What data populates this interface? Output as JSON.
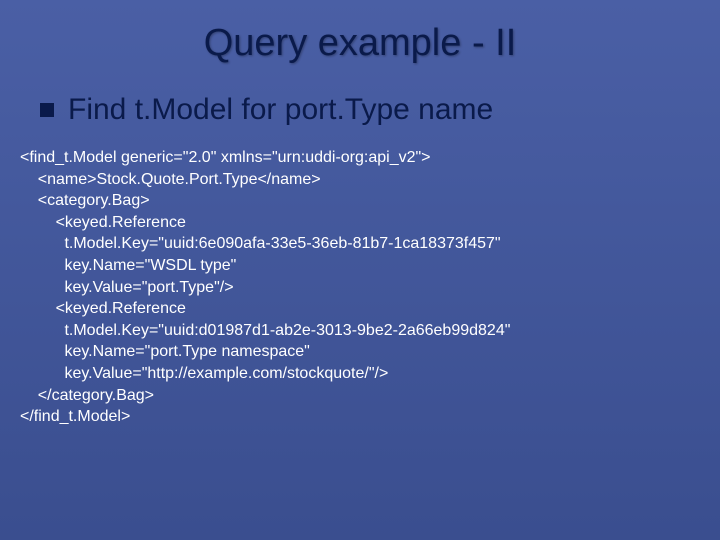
{
  "title": "Query example - II",
  "subhead": "Find t.Model for port.Type name",
  "code": {
    "l0": "<find_t.Model generic=\"2.0\" xmlns=\"urn:uddi-org:api_v2\">",
    "l1": "    <name>Stock.Quote.Port.Type</name>",
    "l2": "    <category.Bag>",
    "l3": "        <keyed.Reference",
    "l4": "          t.Model.Key=\"uuid:6e090afa-33e5-36eb-81b7-1ca18373f457\"",
    "l5": "          key.Name=\"WSDL type\"",
    "l6": "          key.Value=\"port.Type\"/>",
    "l7": "        <keyed.Reference",
    "l8": "          t.Model.Key=\"uuid:d01987d1-ab2e-3013-9be2-2a66eb99d824\"",
    "l9": "          key.Name=\"port.Type namespace\"",
    "l10": "          key.Value=\"http://example.com/stockquote/\"/>",
    "l11": "    </category.Bag>",
    "l12": "</find_t.Model>"
  }
}
